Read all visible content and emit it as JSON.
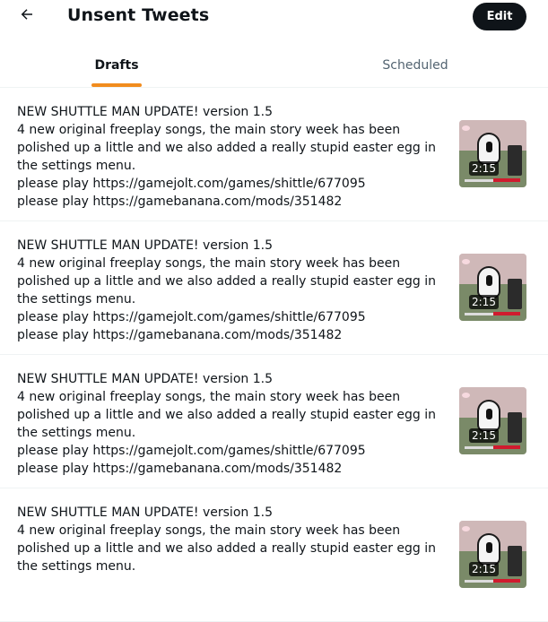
{
  "header": {
    "title": "Unsent Tweets",
    "edit_label": "Edit"
  },
  "tabs": [
    {
      "label": "Drafts",
      "active": true
    },
    {
      "label": "Scheduled",
      "active": false
    }
  ],
  "accent_color": "#f18c1e",
  "drafts": [
    {
      "text": "NEW SHUTTLE MAN UPDATE! version 1.5\n4 new original freeplay songs, the main story week has been polished up a little and we also added a really stupid easter egg in the settings menu.\nplease play https://gamejolt.com/games/shittle/677095\nplease play https://gamebanana.com/mods/351482",
      "video_duration": "2:15"
    },
    {
      "text": "NEW SHUTTLE MAN UPDATE! version 1.5\n4 new original freeplay songs, the main story week has been polished up a little and we also added a really stupid easter egg in the settings menu.\nplease play https://gamejolt.com/games/shittle/677095\nplease play https://gamebanana.com/mods/351482",
      "video_duration": "2:15"
    },
    {
      "text": "NEW SHUTTLE MAN UPDATE! version 1.5\n4 new original freeplay songs, the main story week has been polished up a little and we also added a really stupid easter egg in the settings menu.\nplease play https://gamejolt.com/games/shittle/677095\nplease play https://gamebanana.com/mods/351482",
      "video_duration": "2:15"
    },
    {
      "text": "NEW SHUTTLE MAN UPDATE! version 1.5\n4 new original freeplay songs, the main story week has been polished up a little and we also added a really stupid easter egg in the settings menu.",
      "video_duration": "2:15"
    }
  ]
}
